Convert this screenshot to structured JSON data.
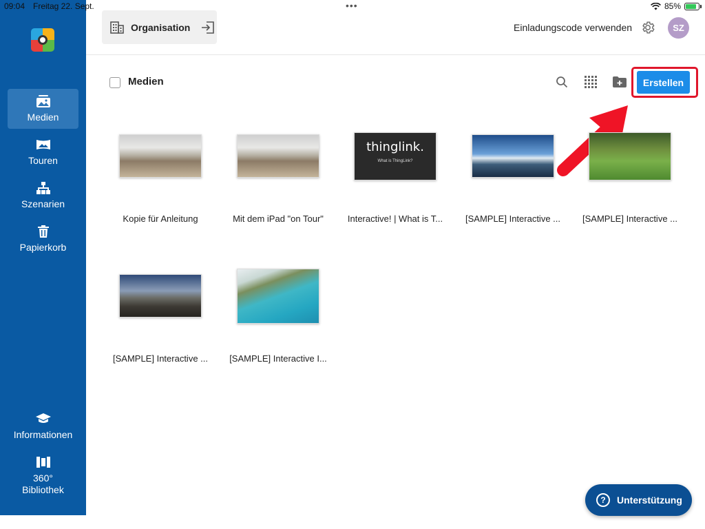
{
  "status_bar": {
    "time": "09:04",
    "date": "Freitag 22. Sept.",
    "battery": "85%"
  },
  "sidebar": {
    "items": [
      {
        "label": "Medien",
        "icon": "images-icon",
        "active": true
      },
      {
        "label": "Touren",
        "icon": "panorama-icon",
        "active": false
      },
      {
        "label": "Szenarien",
        "icon": "hierarchy-icon",
        "active": false
      },
      {
        "label": "Papierkorb",
        "icon": "trash-icon",
        "active": false
      }
    ],
    "bottom_items": [
      {
        "label": "Informationen",
        "icon": "graduation-cap-icon"
      },
      {
        "label": "360°\nBibliothek",
        "icon": "library-icon"
      }
    ]
  },
  "topbar": {
    "org_label": "Organisation",
    "invite_label": "Einladungscode verwenden",
    "avatar_initials": "SZ"
  },
  "content": {
    "section_title": "Medien",
    "create_label": "Erstellen",
    "media": [
      {
        "caption": "Kopie für Anleitung",
        "thumb": "office"
      },
      {
        "caption": "Mit dem iPad \"on Tour\"",
        "thumb": "office"
      },
      {
        "caption": "Interactive! | What is T...",
        "thumb": "thinglink",
        "thumb_title": "thinglink.",
        "thumb_subtitle": "What is ThingLink?"
      },
      {
        "caption": "[SAMPLE] Interactive ...",
        "thumb": "boat"
      },
      {
        "caption": "[SAMPLE] Interactive ...",
        "thumb": "grass"
      },
      {
        "caption": "[SAMPLE] Interactive ...",
        "thumb": "rock"
      },
      {
        "caption": "[SAMPLE] Interactive I...",
        "thumb": "beach"
      }
    ]
  },
  "support_label": "Unterstützung",
  "colors": {
    "sidebar": "#0a5aa3",
    "accent": "#1c8ce8",
    "highlight": "#e0162b",
    "support": "#0b4f93"
  }
}
